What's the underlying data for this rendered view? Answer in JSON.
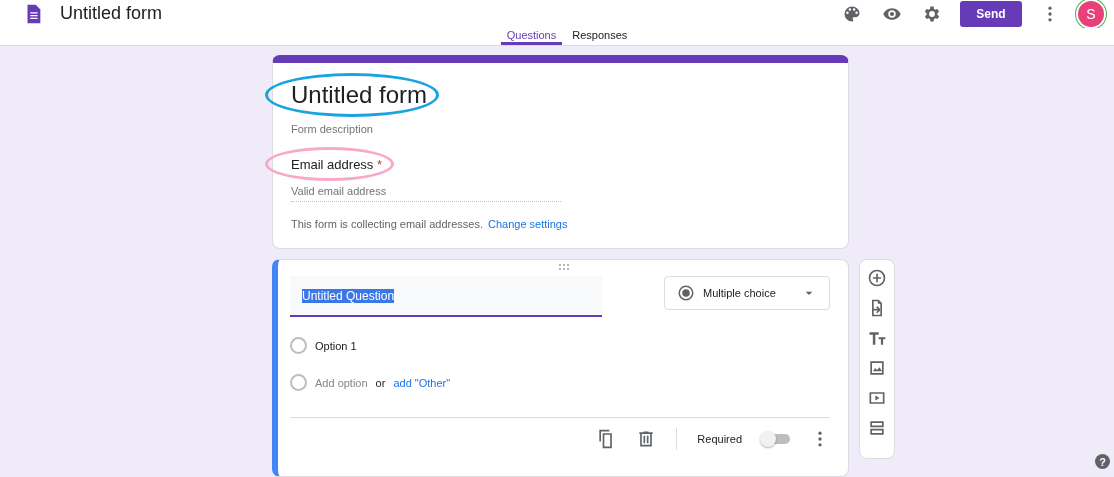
{
  "header": {
    "title": "Untitled form",
    "send": "Send",
    "avatar": "S"
  },
  "tabs": [
    {
      "label": "Questions",
      "selected": true
    },
    {
      "label": "Responses",
      "selected": false
    }
  ],
  "form_header": {
    "title": "Untitled form",
    "description": "Form description",
    "email_label": "Email address",
    "required_mark": "*",
    "email_placeholder": "Valid email address",
    "notice": "This form is collecting email addresses.",
    "notice_link": "Change settings"
  },
  "annotations": [
    {
      "color": "#1aa3e0"
    },
    {
      "color": "#f8a8c8"
    }
  ],
  "help": "?",
  "question": {
    "title": "Untitled Question",
    "title_highlighted": true,
    "type": "Multiple choice",
    "options": [
      {
        "label": "Option 1",
        "selected": false
      }
    ],
    "add_option_selected": false,
    "add_option": "Add option",
    "or": "or",
    "add_other": "add \"Other\"",
    "required_label": "Required",
    "required": false
  }
}
